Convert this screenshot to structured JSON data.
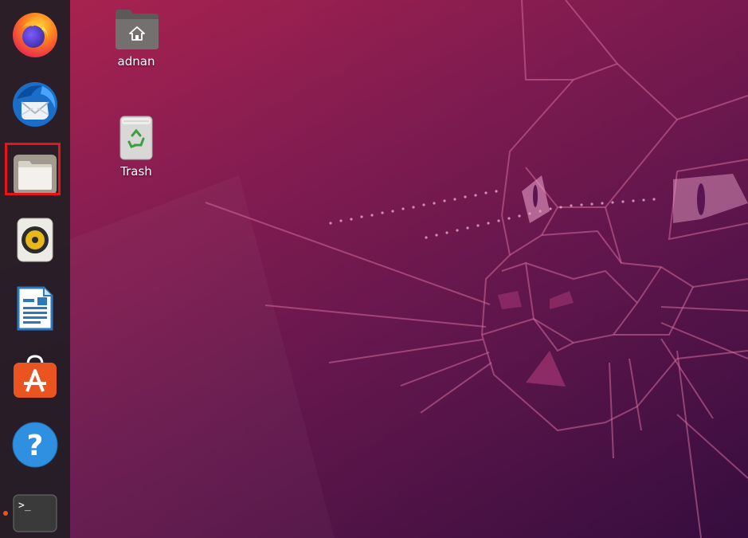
{
  "desktop": {
    "icons": [
      {
        "label": "adnan",
        "icon": "home-folder-icon"
      },
      {
        "label": "Trash",
        "icon": "trash-icon"
      }
    ]
  },
  "dock": {
    "items": [
      {
        "name": "Firefox",
        "icon": "firefox-icon"
      },
      {
        "name": "Thunderbird",
        "icon": "thunderbird-icon"
      },
      {
        "name": "Files",
        "icon": "files-icon",
        "highlighted": true
      },
      {
        "name": "Rhythmbox",
        "icon": "rhythmbox-icon"
      },
      {
        "name": "LibreOffice Writer",
        "icon": "writer-icon"
      },
      {
        "name": "Ubuntu Software",
        "icon": "software-icon"
      },
      {
        "name": "Help",
        "icon": "help-icon"
      },
      {
        "name": "Terminal",
        "icon": "terminal-icon",
        "running": true
      }
    ],
    "help_glyph": "?",
    "terminal_glyph": ">_"
  },
  "colors": {
    "highlight": "#e8131b",
    "ubuntu_orange": "#e95420",
    "dock_bg": "#231e23"
  }
}
